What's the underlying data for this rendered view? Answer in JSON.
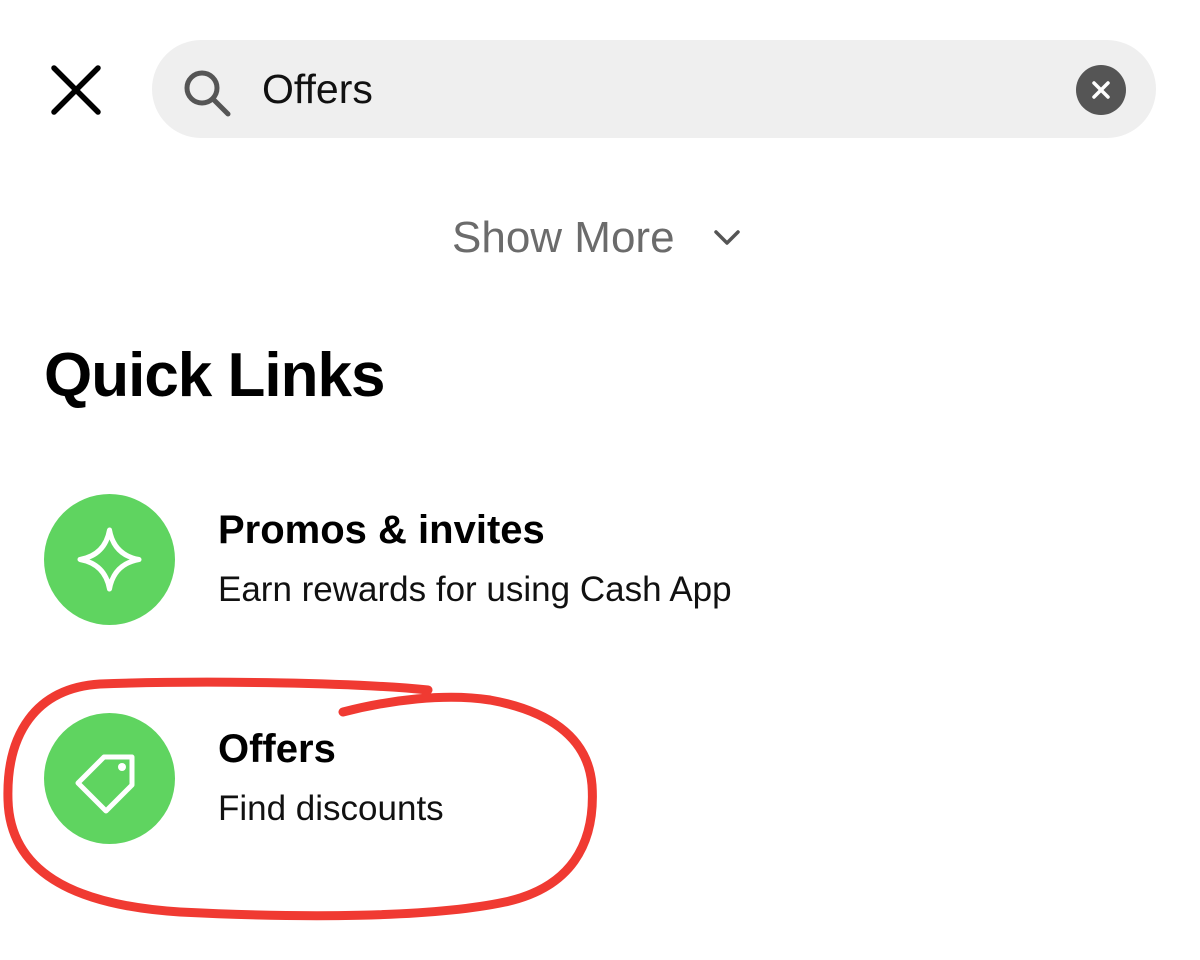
{
  "header": {
    "close_icon": "close-icon",
    "search": {
      "icon": "search-icon",
      "value": "Offers",
      "clear_icon": "clear-icon"
    }
  },
  "show_more": {
    "label": "Show More",
    "icon": "chevron-down-icon"
  },
  "quick_links": {
    "title": "Quick Links",
    "items": [
      {
        "title": "Promos & invites",
        "subtitle": "Earn rewards for using Cash App",
        "icon": "sparkle-icon"
      },
      {
        "title": "Offers",
        "subtitle": "Find discounts",
        "icon": "tag-icon"
      }
    ]
  },
  "colors": {
    "accent_green": "#5fd460",
    "annotation_red": "#f03a32",
    "search_bg": "#efefef",
    "muted_text": "#6b6b6b"
  }
}
